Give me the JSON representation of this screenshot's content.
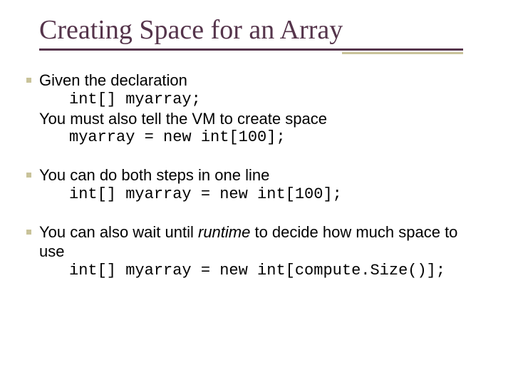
{
  "title": "Creating Space for an Array",
  "block1": {
    "line1": "Given the declaration",
    "code1": "int[] myarray;",
    "line2": "You must also tell the VM to create space",
    "code2": "myarray = new int[100];"
  },
  "block2": {
    "line1": "You can do both steps in one line",
    "code1": "int[] myarray = new int[100];"
  },
  "block3": {
    "pre": "You can also wait until ",
    "runtime": "runtime",
    "post": " to decide how much space to use",
    "code1": "int[] myarray = new int[compute.Size()];"
  }
}
